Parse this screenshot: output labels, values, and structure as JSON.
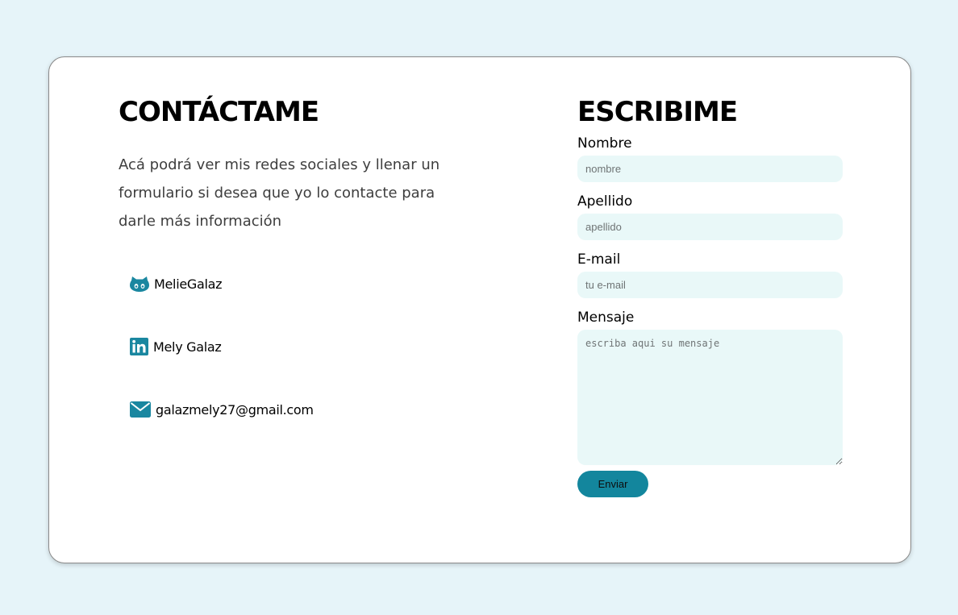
{
  "contact": {
    "title": "CONTÁCTAME",
    "description": "Acá podrá ver mis redes sociales y llenar un formulario si desea que yo lo contacte para darle más información",
    "socials": [
      {
        "icon": "github-icon",
        "label": "MelieGalaz"
      },
      {
        "icon": "linkedin-icon",
        "label": "Mely Galaz"
      },
      {
        "icon": "envelope-icon",
        "label": "galazmely27@gmail.com"
      }
    ]
  },
  "form": {
    "title": "ESCRIBIME",
    "fields": {
      "nombre": {
        "label": "Nombre",
        "placeholder": "nombre",
        "value": ""
      },
      "apellido": {
        "label": "Apellido",
        "placeholder": "apellido",
        "value": ""
      },
      "email": {
        "label": "E-mail",
        "placeholder": "tu e-mail",
        "value": ""
      },
      "mensaje": {
        "label": "Mensaje",
        "placeholder": "escriba aqui su mensaje",
        "value": ""
      }
    },
    "submit_label": "Enviar"
  },
  "colors": {
    "page_background": "#e6f4f9",
    "icon_teal": "#1a87a0",
    "input_background": "#e9f8f8",
    "button_background": "#13869d"
  }
}
